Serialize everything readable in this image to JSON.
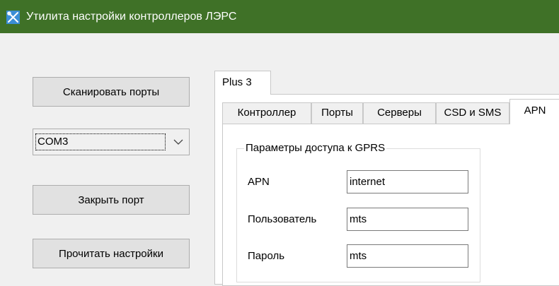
{
  "window": {
    "title": "Утилита настройки контроллеров ЛЭРС",
    "icon": "tools-icon"
  },
  "left_panel": {
    "scan_button": "Сканировать порты",
    "port_select": {
      "value": "COM3",
      "arrow_icon": "chevron-down-icon"
    },
    "close_button": "Закрыть порт",
    "read_button": "Прочитать настройки"
  },
  "outer_tabs": [
    {
      "label": "Plus 3",
      "active": true
    }
  ],
  "inner_tabs": [
    {
      "label": "Контроллер",
      "active": false
    },
    {
      "label": "Порты",
      "active": false
    },
    {
      "label": "Серверы",
      "active": false
    },
    {
      "label": "CSD и SMS",
      "active": false
    },
    {
      "label": "APN",
      "active": true
    }
  ],
  "gprs_group": {
    "title": "Параметры доступа к GPRS",
    "fields": [
      {
        "label": "APN",
        "value": "internet"
      },
      {
        "label": "Пользователь",
        "value": "mts"
      },
      {
        "label": "Пароль",
        "value": "mts"
      }
    ]
  },
  "colors": {
    "titlebar": "#3f7127",
    "icon": "#3b8ed6"
  }
}
